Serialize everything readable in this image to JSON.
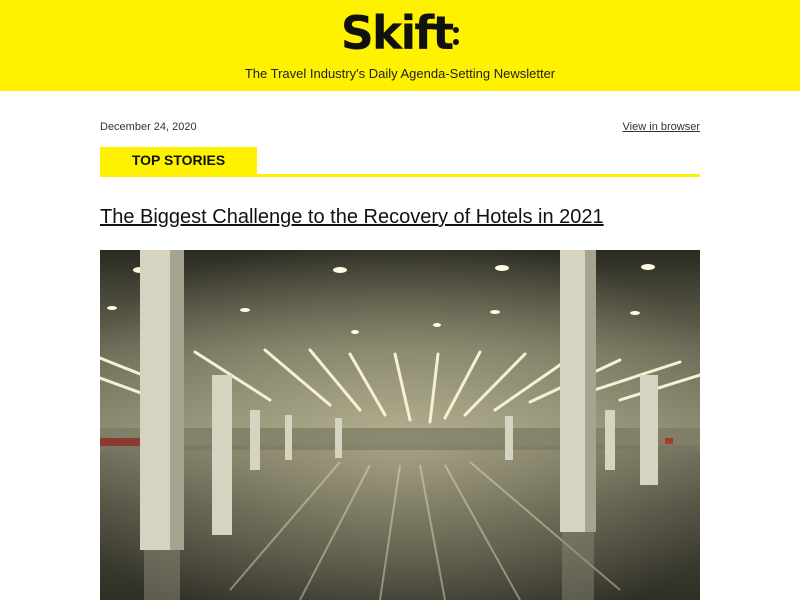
{
  "brand": {
    "logo_text": "Skift",
    "tagline": "The Travel Industry's Daily Agenda-Setting Newsletter",
    "header_color": "#fff200"
  },
  "meta": {
    "date": "December 24, 2020",
    "view_in_browser": "View in browser"
  },
  "section": {
    "label": "TOP STORIES"
  },
  "story": {
    "headline": "The Biggest Challenge to the Recovery of Hotels in 2021",
    "image_icon": "empty-convention-hall-photo"
  }
}
